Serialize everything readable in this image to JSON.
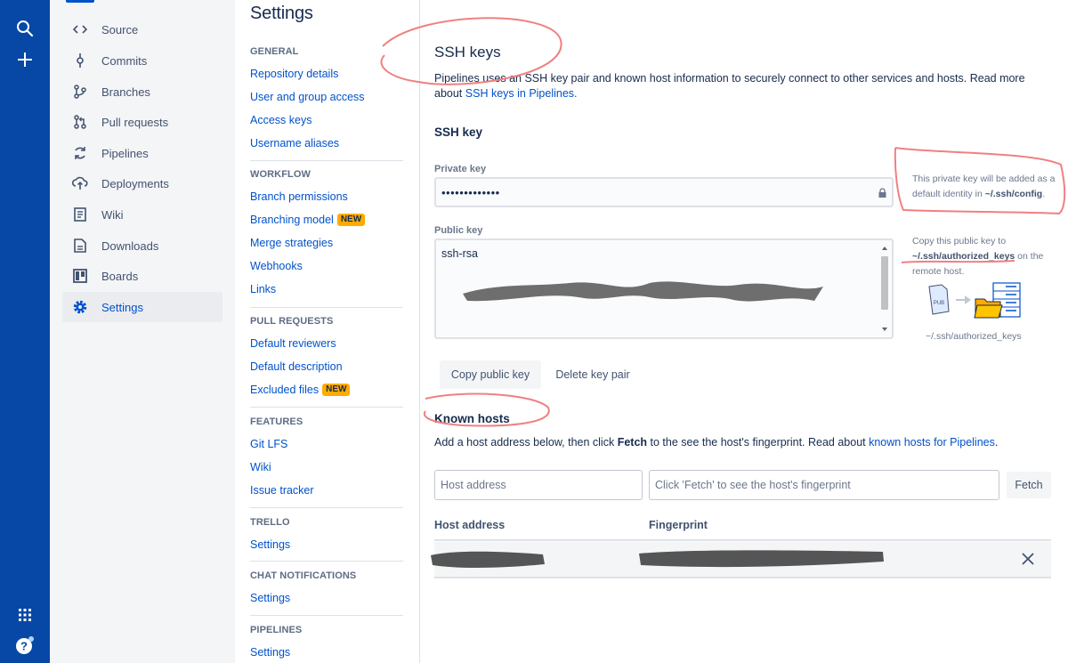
{
  "global_nav": {
    "icons": [
      "search-icon",
      "plus-icon",
      "app-switcher-icon",
      "help-icon"
    ]
  },
  "sidebar": {
    "items": [
      {
        "label": "Source",
        "icon": "source-code-icon"
      },
      {
        "label": "Commits",
        "icon": "commit-icon"
      },
      {
        "label": "Branches",
        "icon": "branch-icon"
      },
      {
        "label": "Pull requests",
        "icon": "pull-request-icon"
      },
      {
        "label": "Pipelines",
        "icon": "pipelines-icon"
      },
      {
        "label": "Deployments",
        "icon": "deployments-icon"
      },
      {
        "label": "Wiki",
        "icon": "wiki-icon"
      },
      {
        "label": "Downloads",
        "icon": "downloads-icon"
      },
      {
        "label": "Boards",
        "icon": "boards-icon"
      },
      {
        "label": "Settings",
        "icon": "gear-icon",
        "active": true
      }
    ]
  },
  "settings": {
    "title": "Settings",
    "general": {
      "heading": "GENERAL",
      "links": [
        "Repository details",
        "User and group access",
        "Access keys",
        "Username aliases"
      ]
    },
    "workflow": {
      "heading": "WORKFLOW",
      "links": [
        "Branch permissions",
        "Branching model",
        "Merge strategies",
        "Webhooks",
        "Links"
      ],
      "new_badge": "NEW"
    },
    "pull_requests": {
      "heading": "PULL REQUESTS",
      "links": [
        "Default reviewers",
        "Default description",
        "Excluded files"
      ],
      "new_badge": "NEW"
    },
    "features": {
      "heading": "FEATURES",
      "links": [
        "Git LFS",
        "Wiki",
        "Issue tracker"
      ]
    },
    "trello": {
      "heading": "TRELLO",
      "links": [
        "Settings"
      ]
    },
    "chat": {
      "heading": "CHAT NOTIFICATIONS",
      "links": [
        "Settings"
      ]
    },
    "pipelines": {
      "heading": "PIPELINES",
      "links": [
        "Settings"
      ]
    }
  },
  "main": {
    "ssh_title": "SSH keys",
    "intro_text": "Pipelines uses an SSH key pair and known host information to securely connect to other services and hosts. Read more about ",
    "intro_link": "SSH keys in Pipelines.",
    "ssh_key_heading": "SSH key",
    "private_key_label": "Private key",
    "private_key_value": "•••••••••••••",
    "private_help_pre": "This private key will be added as a default identity in ",
    "private_help_path": "~/.ssh/config",
    "private_help_post": ".",
    "public_key_label": "Public key",
    "public_key_value": "ssh-rsa",
    "public_help_pre": "Copy this public key to ",
    "public_help_path": "~/.ssh/authorized_keys",
    "public_help_post": " on the remote host.",
    "illustration_file_label": "PUB",
    "illustration_caption": "~/.ssh/authorized_keys",
    "copy_button": "Copy public key",
    "delete_button": "Delete key pair",
    "known_hosts_heading": "Known hosts",
    "known_desc_pre": "Add a host address below, then click ",
    "known_desc_bold": "Fetch",
    "known_desc_mid": " to the see the host's fingerprint. Read about ",
    "known_desc_link": "known hosts for Pipelines",
    "known_desc_post": ".",
    "host_placeholder": "Host address",
    "fingerprint_placeholder": "Click 'Fetch' to see the host's fingerprint",
    "fetch_button": "Fetch",
    "col_host": "Host address",
    "col_fingerprint": "Fingerprint"
  },
  "colors": {
    "global_nav": "#0747A6",
    "link": "#0052CC",
    "badge": "#FFAB00",
    "annotation": "#F08080",
    "redaction": "#555555"
  }
}
